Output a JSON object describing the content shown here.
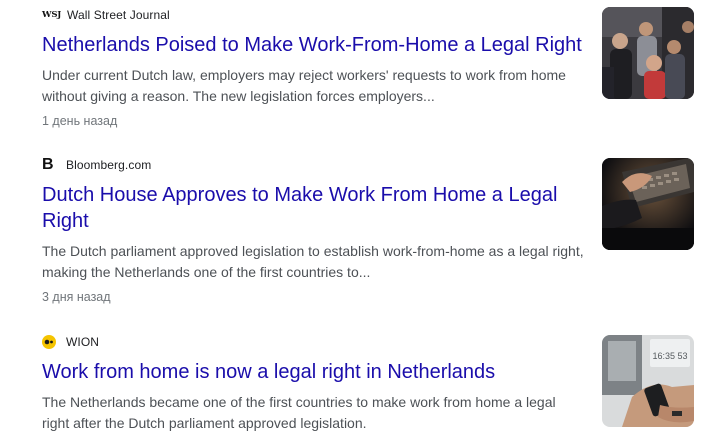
{
  "results": [
    {
      "source": "Wall Street Journal",
      "logo_text": "WSJ",
      "headline": "Netherlands Poised to Make Work-From-Home a Legal Right",
      "snippet_lines": [
        "Under current Dutch law, employers may reject workers' requests to work from home",
        "without giving a reason. The new legislation forces employers..."
      ],
      "time": "1 день назад",
      "thumbnail_icon": "crowd-photo"
    },
    {
      "source": "Bloomberg.com",
      "logo_text": "B",
      "headline_lines": [
        "Dutch House Approves to Make Work From Home a Legal",
        "Right"
      ],
      "snippet_lines": [
        "The Dutch parliament approved legislation to establish work-from-home as a legal right,",
        "making the Netherlands one of the first countries to..."
      ],
      "time": "3 дня назад",
      "thumbnail_icon": "laptop-typing-photo"
    },
    {
      "source": "WION",
      "headline": "Work from home is now a legal right in Netherlands",
      "snippet_lines": [
        "The Netherlands became one of the first countries to make work from home a legal",
        "right after the Dutch parliament approved legislation."
      ],
      "thumbnail_icon": "desk-phone-photo",
      "thumbnail_clock_text": "16:35 53"
    }
  ],
  "colors": {
    "headline_link": "#1a0dab",
    "snippet_text": "#4d5156",
    "time_text": "#70757a",
    "wion_logo": "#f5c400"
  }
}
